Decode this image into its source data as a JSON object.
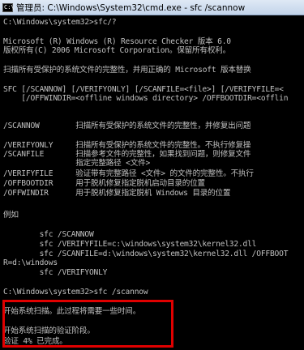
{
  "window": {
    "title": "管理员: C:\\Windows\\System32\\cmd.exe - sfc  /scannow",
    "icon": "console-icon",
    "icon_text": "C:\\",
    "highlight_color": "#e00000"
  },
  "console": {
    "lines": [
      "C:\\Windows\\system32>sfc/?",
      "Microsoft (R) Windows (R) Resource Checker 版本 6.0",
      "版权所有(C) 2006 Microsoft Corporation。保留所有权利。",
      "扫描所有受保护的系统文件的完整性，并用正确的 Microsoft 版本替换",
      "SFC [/SCANNOW] [/VERIFYONLY] [/SCANFILE=<file>] [/VERIFYFILE=<",
      "    [/OFFWINDIR=<offline windows directory> /OFFBOOTDIR=<offlin",
      "/SCANNOW        扫描所有受保护的系统文件的完整性，并修复出问题",
      "/VERIFYONLY     扫描所有受保护的系统文件的完整性。不执行修复操",
      "/SCANFILE       扫描参考文件的完整性，如果找到问题，则修复文件",
      "                指定完整路径 <文件>",
      "/VERIFYFILE     验证带有完整路径 <文件> 的文件的完整性。不执行",
      "/OFFBOOTDIR     用于脱机修复指定脱机启动目录的位置",
      "/OFFWINDIR      用于脱机修复指定脱机 Windows 目录的位置",
      "例如",
      "        sfc /SCANNOW",
      "        sfc /VERIFYFILE=c:\\windows\\system32\\kernel32.dll",
      "        sfc /SCANFILE=d:\\windows\\system32\\kernel32.dll /OFFBOOT",
      "R=d:\\windows",
      "        sfc /VERIFYONLY",
      "C:\\Windows\\system32>sfc /scannow",
      "开始系统扫描。此过程将需要一些时间。",
      "开始系统扫描的验证阶段。",
      "验证 4% 已完成。"
    ]
  }
}
